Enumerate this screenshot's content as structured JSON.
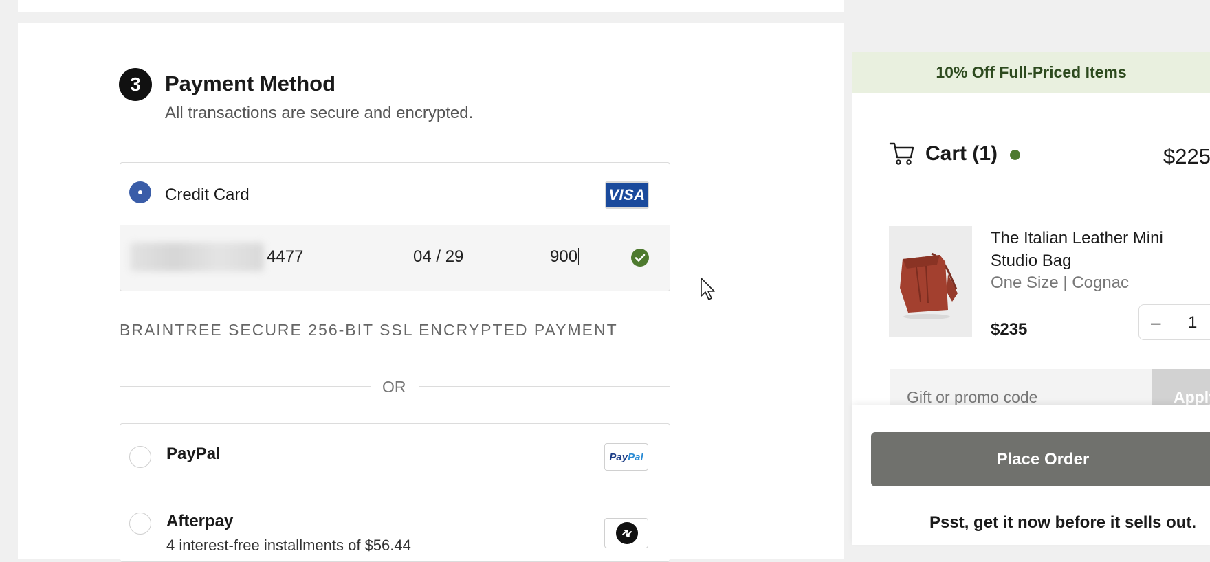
{
  "payment": {
    "step_number": "3",
    "title": "Payment Method",
    "subtitle": "All transactions are secure and encrypted.",
    "credit_card": {
      "label": "Credit Card",
      "selected": true,
      "brand": "VISA",
      "card_last4": "4477",
      "expiry": "04 / 29",
      "cvv": "900",
      "valid": true
    },
    "secure_note": "BRAINTREE SECURE 256-BIT SSL ENCRYPTED PAYMENT",
    "divider_text": "OR",
    "alternatives": [
      {
        "label": "PayPal",
        "logo_text_1": "Pay",
        "logo_text_2": "Pal",
        "icon": "paypal-logo"
      },
      {
        "label": "Afterpay",
        "sub_label": "4 interest-free installments of $56.44",
        "icon": "afterpay-logo"
      }
    ]
  },
  "sidebar": {
    "promo_banner": "10% Off Full-Priced Items",
    "cart": {
      "title": "Cart (1)",
      "total": "$225",
      "items": [
        {
          "name_line_1": "The Italian Leather Mini",
          "name_line_2": "Studio Bag",
          "variant": "One Size | Cognac",
          "price": "$235",
          "quantity": "1",
          "decrement_symbol": "–"
        }
      ]
    },
    "promo_code": {
      "placeholder": "Gift or promo code",
      "apply_label": "Apply"
    },
    "place_order_label": "Place Order",
    "urgency_message": "Psst, get it now before it sells out."
  },
  "colors": {
    "accent_blue": "#3a5da8",
    "success_green": "#4e7a2f",
    "promo_banner_bg": "#e9f0df",
    "place_order_bg": "#70716d"
  }
}
